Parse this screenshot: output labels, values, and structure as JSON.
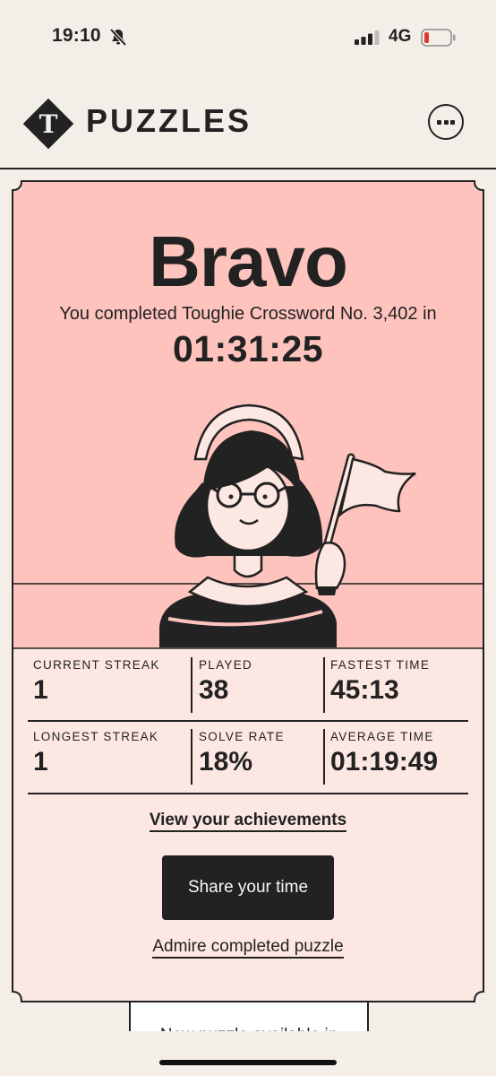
{
  "status_bar": {
    "time": "19:10",
    "network": "4G",
    "icons": [
      "bell-off-icon",
      "signal-icon",
      "battery-low-icon"
    ]
  },
  "header": {
    "brand": "PUZZLES",
    "logo_icon": "telegraph-logo-icon",
    "menu_icon": "more-icon"
  },
  "result": {
    "heading": "Bravo",
    "message": "You completed Toughie Crossword No. 3,402 in",
    "time": "01:31:25"
  },
  "stats": [
    {
      "label": "CURRENT STREAK",
      "value": "1"
    },
    {
      "label": "PLAYED",
      "value": "38"
    },
    {
      "label": "FASTEST TIME",
      "value": "45:13"
    },
    {
      "label": "LONGEST STREAK",
      "value": "1"
    },
    {
      "label": "SOLVE RATE",
      "value": "18%"
    },
    {
      "label": "AVERAGE TIME",
      "value": "01:19:49"
    }
  ],
  "actions": {
    "achievements": "View your achievements",
    "share": "Share your time",
    "admire": "Admire completed puzzle"
  },
  "next_card_text": "New puzzle available in",
  "colors": {
    "background": "#f3efe8",
    "card_top": "#fec3bd",
    "card_bottom": "#fde7e2",
    "ink": "#222222",
    "battery_alert": "#e0362c"
  }
}
